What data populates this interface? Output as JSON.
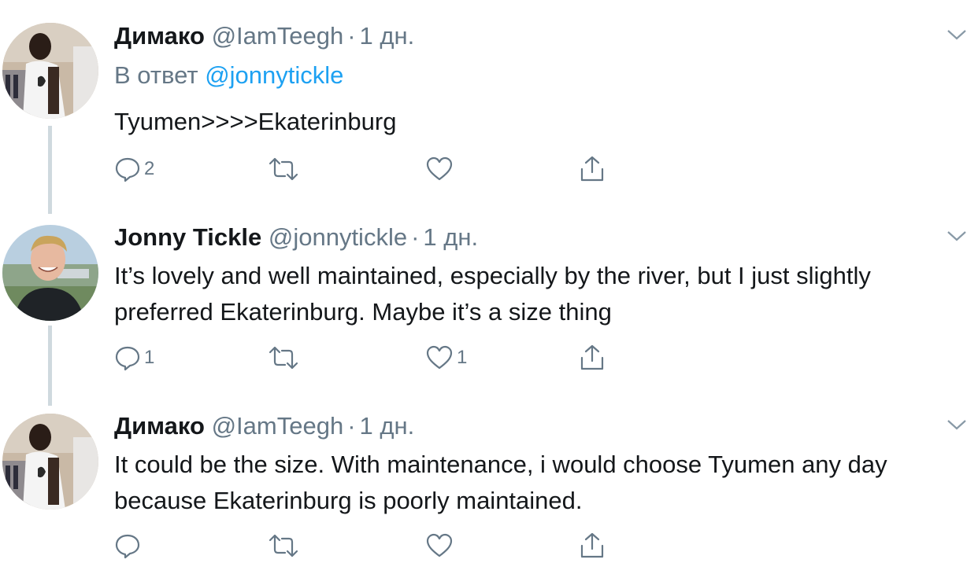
{
  "tweets": [
    {
      "name": "Димако",
      "handle": "@IamTeegh",
      "dot": "·",
      "time": "1 дн.",
      "reply_prefix": "В ответ",
      "reply_mention": "@jonnytickle",
      "text": "Tyumen>>>>Ekaterinburg",
      "reply_count": "2",
      "retweet_count": "",
      "like_count": "",
      "avatar_icon": "user-avatar-photo"
    },
    {
      "name": "Jonny Tickle",
      "handle": "@jonnytickle",
      "dot": "·",
      "time": "1 дн.",
      "text_line1": "It’s lovely and well maintained, especially by the river, but I just slightly",
      "text_line2": "preferred Ekaterinburg. Maybe it’s a size thing",
      "reply_count": "1",
      "retweet_count": "",
      "like_count": "1",
      "avatar_icon": "user-avatar-photo"
    },
    {
      "name": "Димако",
      "handle": "@IamTeegh",
      "dot": "·",
      "time": "1 дн.",
      "text_line1": "It could be the size. With maintenance, i would choose Tyumen any day",
      "text_line2": "because Ekaterinburg is poorly maintained.",
      "reply_count": "",
      "retweet_count": "",
      "like_count": "",
      "avatar_icon": "user-avatar-photo"
    }
  ],
  "colors": {
    "secondary_text": "#657786",
    "link": "#1da1f2",
    "thread_line": "#cfd9de",
    "primary_text": "#14171a"
  },
  "icons": [
    "reply-icon",
    "retweet-icon",
    "like-icon",
    "share-icon",
    "chevron-down-icon"
  ]
}
